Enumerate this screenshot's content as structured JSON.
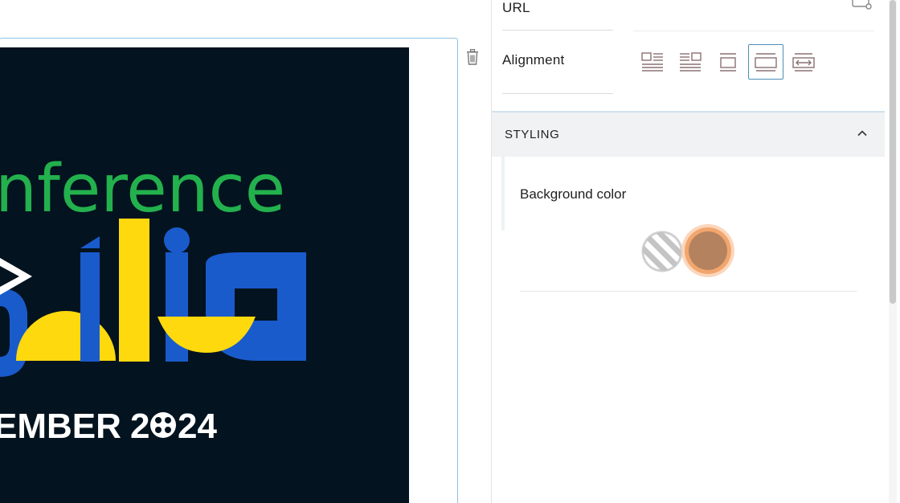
{
  "image_block": {
    "line1": "nference",
    "line2": "sília",
    "line3": "EMBER",
    "year_left": "2",
    "year_right": "24",
    "colors": {
      "background": "#03131f",
      "green": "#23b14d",
      "blue": "#1a5bcc",
      "yellow": "#fdd90e",
      "white": "#ffffff"
    }
  },
  "toolbar": {
    "delete_icon": "trash-icon"
  },
  "sidebar": {
    "url_label": "URL",
    "url_value": "",
    "link_icon": "link-settings-icon",
    "alignment_label": "Alignment",
    "alignment_options": [
      "align-left",
      "align-right",
      "align-center",
      "wide",
      "full-width"
    ],
    "alignment_selected": "wide",
    "styling": {
      "title": "STYLING",
      "expanded": true,
      "background_color_label": "Background color",
      "swatches": [
        {
          "name": "none",
          "color": "transparent",
          "selected": false
        },
        {
          "name": "brown",
          "color": "#b4825f",
          "ring": "#f7b98a",
          "selected": true
        }
      ]
    }
  }
}
